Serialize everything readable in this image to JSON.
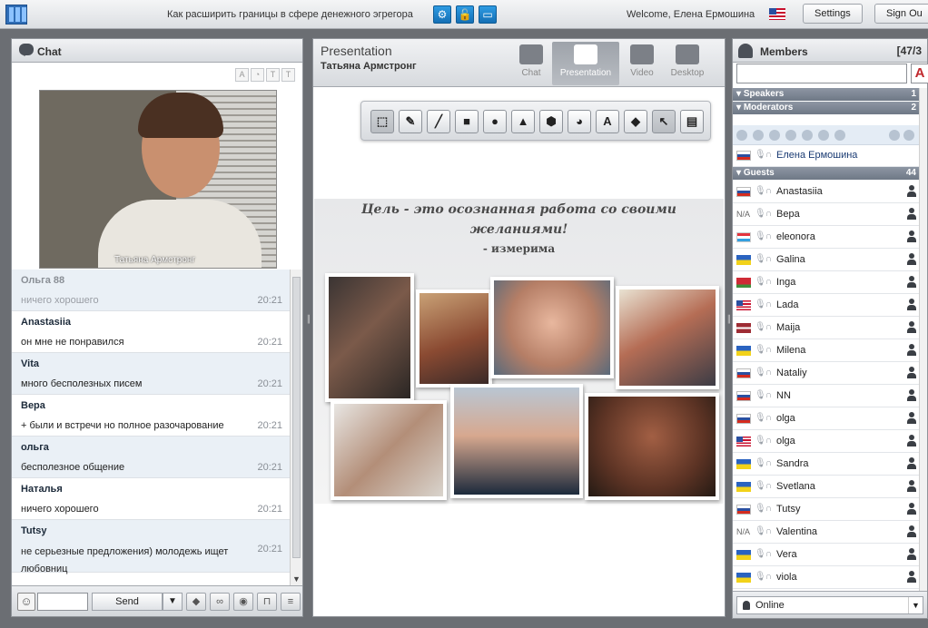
{
  "topbar": {
    "event_title": "Как расширить границы в сфере денежного эгрегора",
    "welcome": "Welcome, Елена Ермошина",
    "settings_label": "Settings",
    "signout_label": "Sign Ou"
  },
  "chat": {
    "title": "Chat",
    "video_name": "Татьяна Армстронг",
    "messages": [
      {
        "author": "Ольга 88",
        "text": "ничего хорошего",
        "time": "20:21"
      },
      {
        "author": "Anastasiia",
        "text": "он мне не понравился",
        "time": "20:21"
      },
      {
        "author": "Vita",
        "text": "много бесполезных писем",
        "time": "20:21"
      },
      {
        "author": "Вера",
        "text": "+ были и встречи но полное разочарование",
        "time": "20:21"
      },
      {
        "author": "ольга",
        "text": "бесполезное общение",
        "time": "20:21"
      },
      {
        "author": "Наталья",
        "text": "ничего хорошего",
        "time": "20:21"
      },
      {
        "author": "Tutsy",
        "text": "не серьезные предложения) молодежь ищет любовниц",
        "time": "20:21"
      }
    ],
    "send_label": "Send"
  },
  "presentation": {
    "title": "Presentation",
    "presenter": "Татьяна Армстронг",
    "tabs": [
      "Chat",
      "Presentation",
      "Video",
      "Desktop"
    ],
    "slide_line1": "Цель - это осознанная работа со своими",
    "slide_line2": "желаниями!",
    "slide_line3": "- измерима"
  },
  "members": {
    "title": "Members",
    "count": "[47/3",
    "groups": {
      "speakers": {
        "label": "Speakers",
        "count": "1"
      },
      "moderators": {
        "label": "Moderators",
        "count": "2"
      },
      "guests": {
        "label": "Guests",
        "count": "44"
      }
    },
    "moderator_name": "Елена Ермошина",
    "guests": [
      {
        "name": "Anastasiia",
        "flag": "ru"
      },
      {
        "name": "Вера",
        "flag": "na"
      },
      {
        "name": "eleonora",
        "flag": "lu"
      },
      {
        "name": "Galina",
        "flag": "ua"
      },
      {
        "name": "Inga",
        "flag": "by"
      },
      {
        "name": "Lada",
        "flag": "us"
      },
      {
        "name": "Maija",
        "flag": "lv"
      },
      {
        "name": "Milena",
        "flag": "ua"
      },
      {
        "name": "Nataliy",
        "flag": "ru"
      },
      {
        "name": "NN",
        "flag": "ru"
      },
      {
        "name": "olga",
        "flag": "ru"
      },
      {
        "name": "olga",
        "flag": "us"
      },
      {
        "name": "Sandra",
        "flag": "ua"
      },
      {
        "name": "Svetlana",
        "flag": "ua"
      },
      {
        "name": "Tutsy",
        "flag": "ru"
      },
      {
        "name": "Valentina",
        "flag": "na"
      },
      {
        "name": "Vera",
        "flag": "ua"
      },
      {
        "name": "viola",
        "flag": "ua"
      }
    ],
    "status": "Online"
  }
}
